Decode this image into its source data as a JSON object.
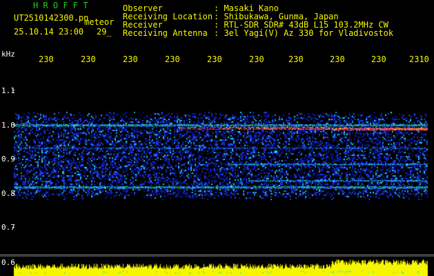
{
  "header": {
    "app_name": "H R O F F T",
    "file_name": "UT2510142300.pn",
    "mode": "meteor",
    "datetime": "25.10.14 23:00",
    "count": "29_",
    "fields": [
      {
        "label": "Observer",
        "value": ": Masaki Kano"
      },
      {
        "label": "Receiving Location",
        "value": ": Shibukawa, Gunma, Japan"
      },
      {
        "label": "Receiver",
        "value": ": RTL-SDR SDR# 43dB L15 103.2MHz CW"
      },
      {
        "label": "Receiving Antenna",
        "value": ": 3el Yagi(V) Az 330 for Vladivostok"
      }
    ]
  },
  "axis": {
    "unit": "kHz",
    "y_ticks": [
      "1.1",
      "1.0",
      "0.9",
      "0.8",
      "0.7",
      "0.6"
    ],
    "x_ticks": [
      "230",
      "230",
      "230",
      "230",
      "230",
      "230",
      "230",
      "230",
      "230",
      "2310"
    ]
  },
  "colors": {
    "header_green": "#1fd11f",
    "header_yellow": "#f6f600",
    "axis_white": "#ffffff",
    "tick_yellow": "#f6f600",
    "echo_red": "#ff2a6a"
  }
}
